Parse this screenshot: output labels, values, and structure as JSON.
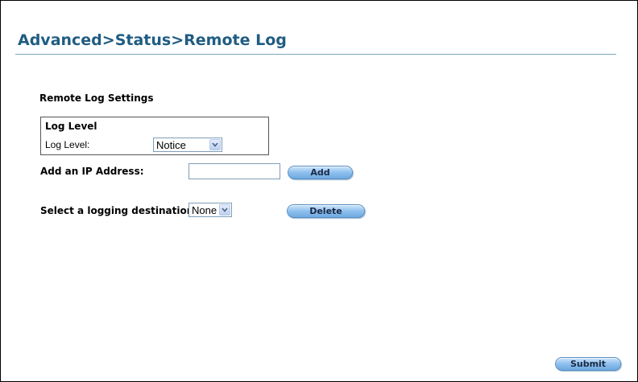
{
  "page": {
    "title": "Advanced>Status>Remote Log",
    "accent_color": "#1f5c83"
  },
  "remote_log": {
    "section_heading": "Remote Log Settings",
    "log_level_box": {
      "title": "Log Level",
      "label": "Log Level:",
      "selected": "Notice"
    },
    "add_ip": {
      "label": "Add an IP Address:",
      "value": "",
      "add_label": "Add"
    },
    "destination": {
      "label": "Select a logging destination:",
      "selected": "None",
      "delete_label": "Delete"
    }
  },
  "footer": {
    "submit_label": "Submit"
  },
  "icons": {
    "dropdown": "chevron-down-icon"
  }
}
